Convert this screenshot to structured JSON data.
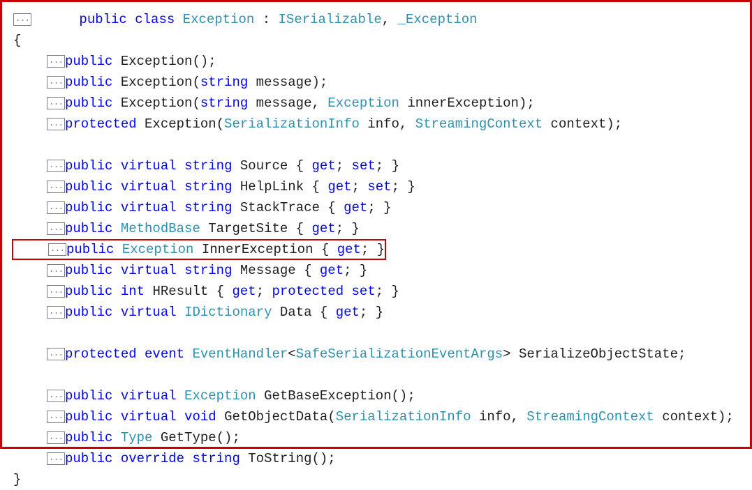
{
  "fold": "...",
  "decl": {
    "kw_public": "public",
    "kw_class": "class",
    "type_exception": "Exception",
    "colon": ":",
    "type_iserializable": "ISerializable",
    "comma": ",",
    "type_under_exception": "_Exception"
  },
  "brace_open": "{",
  "brace_close": "}",
  "ctors": [
    {
      "parts": [
        {
          "cls": "kw",
          "t": "public"
        },
        {
          "cls": "txt",
          "t": " Exception();"
        }
      ]
    },
    {
      "parts": [
        {
          "cls": "kw",
          "t": "public"
        },
        {
          "cls": "txt",
          "t": " Exception("
        },
        {
          "cls": "kw",
          "t": "string"
        },
        {
          "cls": "txt",
          "t": " message);"
        }
      ]
    },
    {
      "parts": [
        {
          "cls": "kw",
          "t": "public"
        },
        {
          "cls": "txt",
          "t": " Exception("
        },
        {
          "cls": "kw",
          "t": "string"
        },
        {
          "cls": "txt",
          "t": " message, "
        },
        {
          "cls": "type",
          "t": "Exception"
        },
        {
          "cls": "txt",
          "t": " innerException);"
        }
      ]
    },
    {
      "parts": [
        {
          "cls": "kw",
          "t": "protected"
        },
        {
          "cls": "txt",
          "t": " Exception("
        },
        {
          "cls": "type",
          "t": "SerializationInfo"
        },
        {
          "cls": "txt",
          "t": " info, "
        },
        {
          "cls": "type",
          "t": "StreamingContext"
        },
        {
          "cls": "txt",
          "t": " context);"
        }
      ]
    }
  ],
  "props1": [
    {
      "parts": [
        {
          "cls": "kw",
          "t": "public"
        },
        {
          "cls": "txt",
          "t": " "
        },
        {
          "cls": "kw",
          "t": "virtual"
        },
        {
          "cls": "txt",
          "t": " "
        },
        {
          "cls": "kw",
          "t": "string"
        },
        {
          "cls": "txt",
          "t": " Source { "
        },
        {
          "cls": "kw",
          "t": "get"
        },
        {
          "cls": "txt",
          "t": "; "
        },
        {
          "cls": "kw",
          "t": "set"
        },
        {
          "cls": "txt",
          "t": "; }"
        }
      ]
    },
    {
      "parts": [
        {
          "cls": "kw",
          "t": "public"
        },
        {
          "cls": "txt",
          "t": " "
        },
        {
          "cls": "kw",
          "t": "virtual"
        },
        {
          "cls": "txt",
          "t": " "
        },
        {
          "cls": "kw",
          "t": "string"
        },
        {
          "cls": "txt",
          "t": " HelpLink { "
        },
        {
          "cls": "kw",
          "t": "get"
        },
        {
          "cls": "txt",
          "t": "; "
        },
        {
          "cls": "kw",
          "t": "set"
        },
        {
          "cls": "txt",
          "t": "; }"
        }
      ]
    },
    {
      "parts": [
        {
          "cls": "kw",
          "t": "public"
        },
        {
          "cls": "txt",
          "t": " "
        },
        {
          "cls": "kw",
          "t": "virtual"
        },
        {
          "cls": "txt",
          "t": " "
        },
        {
          "cls": "kw",
          "t": "string"
        },
        {
          "cls": "txt",
          "t": " StackTrace { "
        },
        {
          "cls": "kw",
          "t": "get"
        },
        {
          "cls": "txt",
          "t": "; }"
        }
      ]
    },
    {
      "parts": [
        {
          "cls": "kw",
          "t": "public"
        },
        {
          "cls": "txt",
          "t": " "
        },
        {
          "cls": "type",
          "t": "MethodBase"
        },
        {
          "cls": "txt",
          "t": " TargetSite { "
        },
        {
          "cls": "kw",
          "t": "get"
        },
        {
          "cls": "txt",
          "t": "; }"
        }
      ]
    }
  ],
  "highlighted": {
    "parts": [
      {
        "cls": "kw",
        "t": "public"
      },
      {
        "cls": "txt",
        "t": " "
      },
      {
        "cls": "type",
        "t": "Exception"
      },
      {
        "cls": "txt",
        "t": " InnerException { "
      },
      {
        "cls": "kw",
        "t": "get"
      },
      {
        "cls": "txt",
        "t": "; }"
      }
    ]
  },
  "props2": [
    {
      "parts": [
        {
          "cls": "kw",
          "t": "public"
        },
        {
          "cls": "txt",
          "t": " "
        },
        {
          "cls": "kw",
          "t": "virtual"
        },
        {
          "cls": "txt",
          "t": " "
        },
        {
          "cls": "kw",
          "t": "string"
        },
        {
          "cls": "txt",
          "t": " Message { "
        },
        {
          "cls": "kw",
          "t": "get"
        },
        {
          "cls": "txt",
          "t": "; }"
        }
      ]
    },
    {
      "parts": [
        {
          "cls": "kw",
          "t": "public"
        },
        {
          "cls": "txt",
          "t": " "
        },
        {
          "cls": "kw",
          "t": "int"
        },
        {
          "cls": "txt",
          "t": " HResult { "
        },
        {
          "cls": "kw",
          "t": "get"
        },
        {
          "cls": "txt",
          "t": "; "
        },
        {
          "cls": "kw",
          "t": "protected"
        },
        {
          "cls": "txt",
          "t": " "
        },
        {
          "cls": "kw",
          "t": "set"
        },
        {
          "cls": "txt",
          "t": "; }"
        }
      ]
    },
    {
      "parts": [
        {
          "cls": "kw",
          "t": "public"
        },
        {
          "cls": "txt",
          "t": " "
        },
        {
          "cls": "kw",
          "t": "virtual"
        },
        {
          "cls": "txt",
          "t": " "
        },
        {
          "cls": "type",
          "t": "IDictionary"
        },
        {
          "cls": "txt",
          "t": " Data { "
        },
        {
          "cls": "kw",
          "t": "get"
        },
        {
          "cls": "txt",
          "t": "; }"
        }
      ]
    }
  ],
  "event": {
    "parts": [
      {
        "cls": "kw",
        "t": "protected"
      },
      {
        "cls": "txt",
        "t": " "
      },
      {
        "cls": "kw",
        "t": "event"
      },
      {
        "cls": "txt",
        "t": " "
      },
      {
        "cls": "type",
        "t": "EventHandler"
      },
      {
        "cls": "txt",
        "t": "<"
      },
      {
        "cls": "type",
        "t": "SafeSerializationEventArgs"
      },
      {
        "cls": "txt",
        "t": "> SerializeObjectState;"
      }
    ]
  },
  "methods": [
    {
      "parts": [
        {
          "cls": "kw",
          "t": "public"
        },
        {
          "cls": "txt",
          "t": " "
        },
        {
          "cls": "kw",
          "t": "virtual"
        },
        {
          "cls": "txt",
          "t": " "
        },
        {
          "cls": "type",
          "t": "Exception"
        },
        {
          "cls": "txt",
          "t": " GetBaseException();"
        }
      ]
    },
    {
      "parts": [
        {
          "cls": "kw",
          "t": "public"
        },
        {
          "cls": "txt",
          "t": " "
        },
        {
          "cls": "kw",
          "t": "virtual"
        },
        {
          "cls": "txt",
          "t": " "
        },
        {
          "cls": "kw",
          "t": "void"
        },
        {
          "cls": "txt",
          "t": " GetObjectData("
        },
        {
          "cls": "type",
          "t": "SerializationInfo"
        },
        {
          "cls": "txt",
          "t": " info, "
        },
        {
          "cls": "type",
          "t": "StreamingContext"
        },
        {
          "cls": "txt",
          "t": " context);"
        }
      ]
    },
    {
      "parts": [
        {
          "cls": "kw",
          "t": "public"
        },
        {
          "cls": "txt",
          "t": " "
        },
        {
          "cls": "type",
          "t": "Type"
        },
        {
          "cls": "txt",
          "t": " GetType();"
        }
      ]
    },
    {
      "parts": [
        {
          "cls": "kw",
          "t": "public"
        },
        {
          "cls": "txt",
          "t": " "
        },
        {
          "cls": "kw",
          "t": "override"
        },
        {
          "cls": "txt",
          "t": " "
        },
        {
          "cls": "kw",
          "t": "string"
        },
        {
          "cls": "txt",
          "t": " ToString();"
        }
      ]
    }
  ]
}
